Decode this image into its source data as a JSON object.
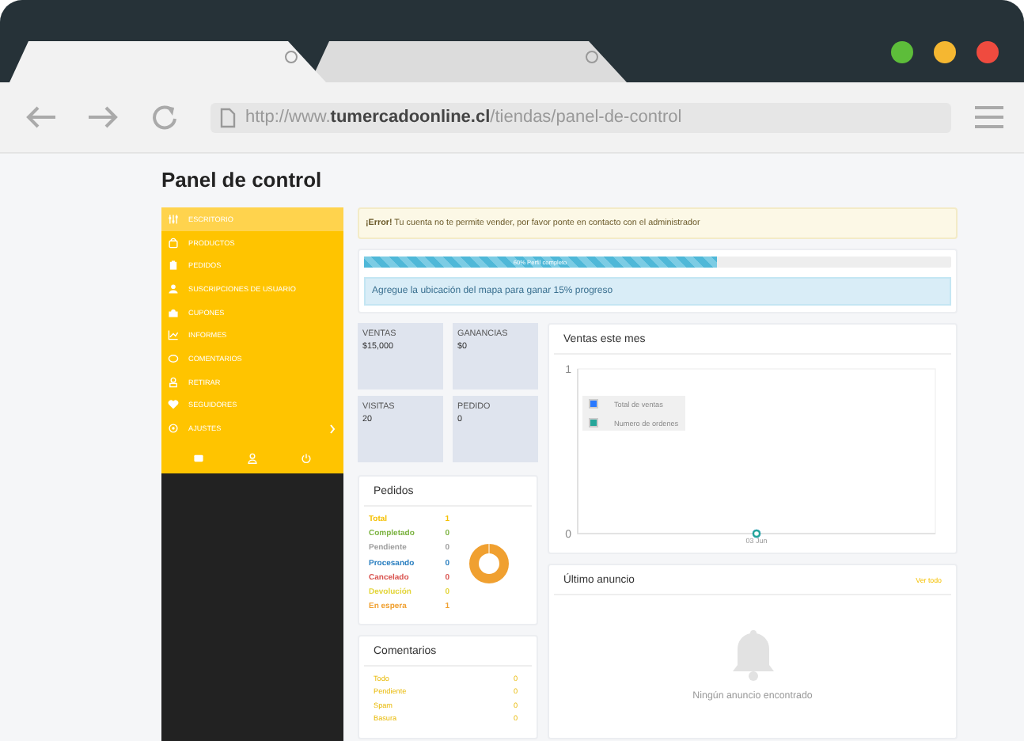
{
  "browser": {
    "tabs": [
      {
        "selected": true
      },
      {
        "selected": false
      }
    ],
    "url": "http://www.**tumercadoonline.cl**/tiendas/panel-de-control"
  },
  "page_title": "Panel de control",
  "sidebar": {
    "items": [
      {
        "label": "ESCRITORIO",
        "selected": true,
        "submenu": false
      },
      {
        "label": "PRODUCTOS",
        "selected": false,
        "submenu": false
      },
      {
        "label": "PEDIDOS",
        "selected": false,
        "submenu": false
      },
      {
        "label": "SUSCRIPCIONES DE USUARIO",
        "selected": false,
        "submenu": false
      },
      {
        "label": "CUPONES",
        "selected": false,
        "submenu": false
      },
      {
        "label": "INFORMES",
        "selected": false,
        "submenu": false
      },
      {
        "label": "COMENTARIOS",
        "selected": false,
        "submenu": false
      },
      {
        "label": "RETIRAR",
        "selected": false,
        "submenu": false
      },
      {
        "label": "SEGUIDORES",
        "selected": false,
        "submenu": false
      },
      {
        "label": "AJUSTES",
        "selected": false,
        "submenu": true
      }
    ]
  },
  "alert": "**¡Error!** Tu cuenta no te permite vender, por favor ponte en contacto con el administrador",
  "profile": {
    "level": 0.6,
    "reading": "60% Perfil completo",
    "hint": "Agregue la ubicación del mapa para ganar 15% progreso"
  },
  "stats": [
    {
      "label": "VENTAS",
      "value": "$15,000"
    },
    {
      "label": "GANANCIAS",
      "value": "$0"
    },
    {
      "label": "VISITAS",
      "value": "20"
    },
    {
      "label": "PEDIDO",
      "value": "0"
    }
  ],
  "orders": {
    "title": "Pedidos",
    "rows": [
      {
        "label": "Total",
        "value": "1",
        "color": "#f5c000"
      },
      {
        "label": "Completado",
        "value": "0",
        "color": "#7cb342"
      },
      {
        "label": "Pendiente",
        "value": "0",
        "color": "#9e9e9e"
      },
      {
        "label": "Procesando",
        "value": "0",
        "color": "#2a7fc0"
      },
      {
        "label": "Cancelado",
        "value": "0",
        "color": "#d9534f"
      },
      {
        "label": "Devolución",
        "value": "0",
        "color": "#e3d53a"
      },
      {
        "label": "En espera",
        "value": "1",
        "color": "#f0a030"
      }
    ]
  },
  "comments": {
    "title": "Comentarios",
    "rows": [
      {
        "label": "Todo",
        "value": "0"
      },
      {
        "label": "Pendiente",
        "value": "0"
      },
      {
        "label": "Spam",
        "value": "0"
      },
      {
        "label": "Basura",
        "value": "0"
      }
    ]
  },
  "sales": {
    "title": "Ventas este mes",
    "chart_data": {
      "type": "line",
      "categories": [
        "03 Jun"
      ],
      "ylim": [
        0,
        1
      ],
      "yticks": [
        {
          "value": 0,
          "label": "0"
        },
        {
          "value": 1,
          "label": "1"
        }
      ],
      "series": [
        {
          "name": "Total de ventas",
          "color": "#2979ff",
          "marker": "circle",
          "values": [
            0
          ]
        },
        {
          "name": "Numero de ordenes",
          "color": "#26a69a",
          "marker": "circle",
          "values": [
            0
          ]
        }
      ]
    }
  },
  "announcement": {
    "title": "Último anuncio",
    "link": "Ver todo",
    "empty": "Ningún anuncio encontrado"
  }
}
